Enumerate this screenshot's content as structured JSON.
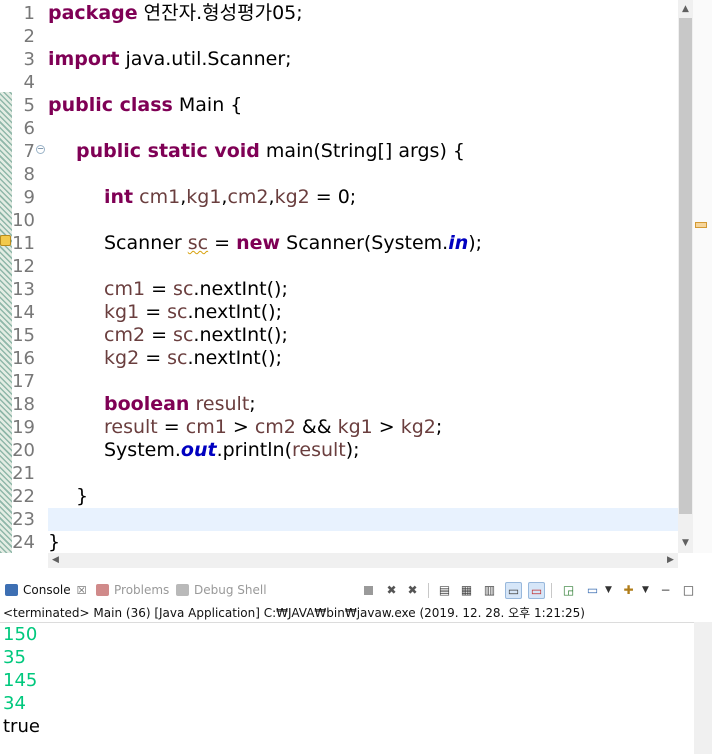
{
  "editor": {
    "line_numbers": [
      "1",
      "2",
      "3",
      "4",
      "5",
      "6",
      "7",
      "8",
      "9",
      "10",
      "11",
      "12",
      "13",
      "14",
      "15",
      "16",
      "17",
      "18",
      "19",
      "20",
      "21",
      "22",
      "23",
      "24"
    ],
    "lines": {
      "l1": [
        "package",
        " 연잔자.형성평가05;"
      ],
      "l3": [
        "import",
        " java.util.Scanner;"
      ],
      "l5": [
        "public class",
        " Main {"
      ],
      "l7": [
        "public static void",
        " main(String[] args) {"
      ],
      "l9": [
        "int",
        " ",
        "cm1",
        ",",
        "kg1",
        ",",
        "cm2",
        ",",
        "kg2",
        " = 0;"
      ],
      "l11": [
        "Scanner ",
        "sc",
        " = ",
        "new",
        " Scanner(System.",
        "in",
        ");"
      ],
      "l13": [
        "cm1",
        " = ",
        "sc",
        ".nextInt();"
      ],
      "l14": [
        "kg1",
        " = ",
        "sc",
        ".nextInt();"
      ],
      "l15": [
        "cm2",
        " = ",
        "sc",
        ".nextInt();"
      ],
      "l16": [
        "kg2",
        " = ",
        "sc",
        ".nextInt();"
      ],
      "l18": [
        "boolean",
        " ",
        "result",
        ";"
      ],
      "l19": [
        "result",
        " = ",
        "cm1",
        " > ",
        "cm2",
        " && ",
        "kg1",
        " > ",
        "kg2",
        ";"
      ],
      "l20": [
        "System.",
        "out",
        ".println(",
        "result",
        ");"
      ],
      "l22": [
        "}"
      ],
      "l24": [
        "}"
      ]
    }
  },
  "console": {
    "tabs": [
      {
        "label": "Console",
        "close": "☒"
      },
      {
        "label": "Problems"
      },
      {
        "label": "Debug Shell"
      }
    ],
    "process_line": "<terminated> Main (36) [Java Application] C:₩JAVA₩bin₩javaw.exe (2019. 12. 28. 오후 1:21:25)",
    "output": [
      "150",
      "35",
      "145",
      "34",
      "true"
    ],
    "output_colors": {
      "input": "#00c87d",
      "stdout": "#000000"
    }
  },
  "icons": [
    "fold-collapse-icon",
    "warning-marker-icon",
    "console-icon",
    "problems-icon",
    "debug-shell-icon",
    "terminate-icon",
    "remove-launch-icon",
    "remove-all-icon",
    "clear-console-icon",
    "scroll-lock-icon",
    "word-wrap-icon",
    "show-on-stdout-icon",
    "show-on-stderr-icon",
    "pin-console-icon",
    "display-console-icon",
    "open-console-icon",
    "minimize-icon",
    "maximize-icon"
  ]
}
